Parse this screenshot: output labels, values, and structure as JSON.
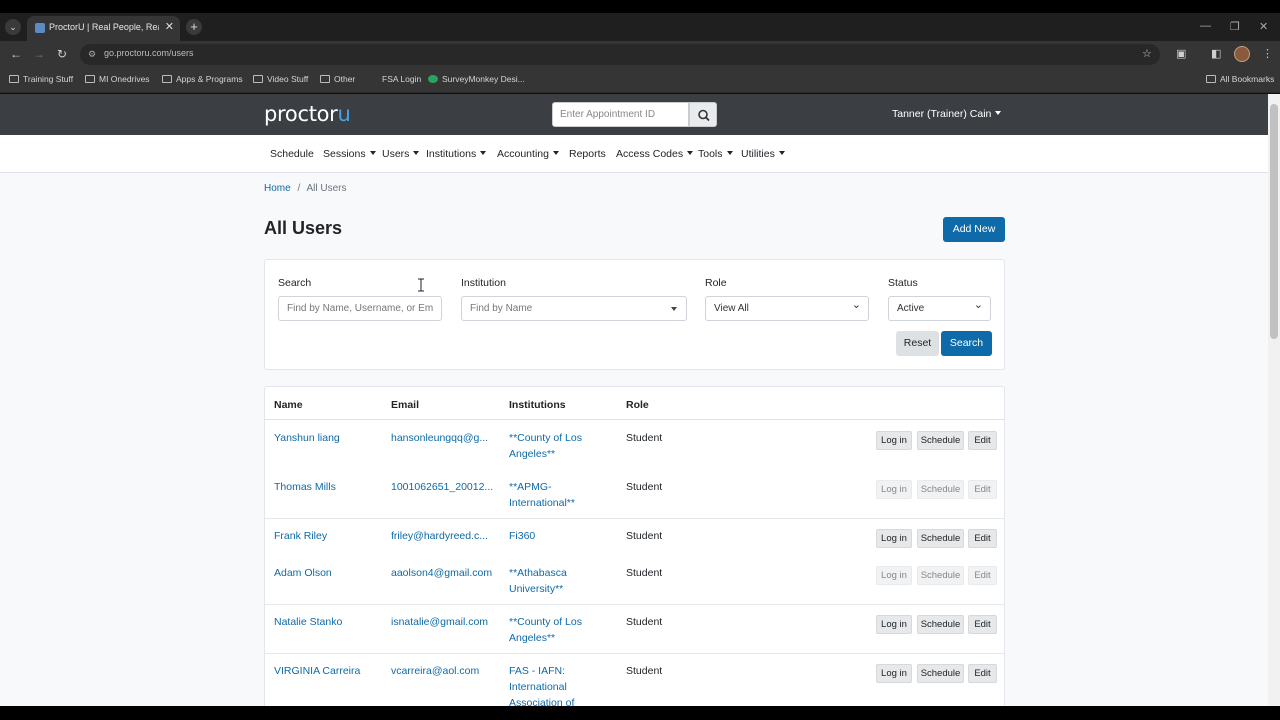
{
  "browser": {
    "tab_title": "ProctorU | Real People, Real Pro",
    "url": "go.proctoru.com/users",
    "bookmarks": [
      {
        "label": "Training Stuff",
        "icon": "folder-icon"
      },
      {
        "label": "MI Onedrives",
        "icon": "folder-icon"
      },
      {
        "label": "Apps & Programs",
        "icon": "folder-icon"
      },
      {
        "label": "Video Stuff",
        "icon": "folder-icon"
      },
      {
        "label": "Other",
        "icon": "folder-icon"
      },
      {
        "label": "FSA Login",
        "icon": "fsa-icon"
      },
      {
        "label": "SurveyMonkey Desi...",
        "icon": "surveymonkey-icon"
      }
    ],
    "all_bookmarks": "All Bookmarks"
  },
  "header": {
    "logo": "proctor",
    "logo_u": "u",
    "appointment_placeholder": "Enter Appointment ID",
    "user": "Tanner (Trainer) Cain"
  },
  "nav": [
    "Schedule",
    "Sessions",
    "Users",
    "Institutions",
    "Accounting",
    "Reports",
    "Access Codes",
    "Tools",
    "Utilities"
  ],
  "breadcrumb": {
    "home": "Home",
    "separator": "/",
    "current": "All Users"
  },
  "page_title": "All Users",
  "add_new": "Add New",
  "filters": {
    "search_label": "Search",
    "search_placeholder": "Find by Name, Username, or Em",
    "institution_label": "Institution",
    "institution_placeholder": "Find by Name",
    "role_label": "Role",
    "role_value": "View All",
    "status_label": "Status",
    "status_value": "Active",
    "reset": "Reset",
    "search": "Search"
  },
  "table": {
    "headers": [
      "Name",
      "Email",
      "Institutions",
      "Role"
    ],
    "actions": {
      "login": "Log in",
      "schedule": "Schedule",
      "edit": "Edit"
    },
    "rows": [
      {
        "name": "Yanshun liang",
        "email": "hansonleungqq@g...",
        "inst1": "**County of Los",
        "inst2": "Angeles**",
        "inst3": "",
        "role": "Student"
      },
      {
        "name": "Thomas Mills",
        "email": "1001062651_20012...",
        "inst1": "**APMG-",
        "inst2": "International**",
        "inst3": "",
        "role": "Student"
      },
      {
        "name": "Frank Riley",
        "email": "friley@hardyreed.c...",
        "inst1": "Fi360",
        "inst2": "",
        "inst3": "",
        "role": "Student"
      },
      {
        "name": "Adam Olson",
        "email": "aaolson4@gmail.com",
        "inst1": "**Athabasca",
        "inst2": "University**",
        "inst3": "",
        "role": "Student"
      },
      {
        "name": "Natalie Stanko",
        "email": "isnatalie@gmail.com",
        "inst1": "**County of Los",
        "inst2": "Angeles**",
        "inst3": "",
        "role": "Student"
      },
      {
        "name": "VIRGINIA Carreira",
        "email": "vcarreira@aol.com",
        "inst1": "FAS - IAFN:",
        "inst2": "International",
        "inst3": "Association of",
        "role": "Student"
      }
    ]
  }
}
